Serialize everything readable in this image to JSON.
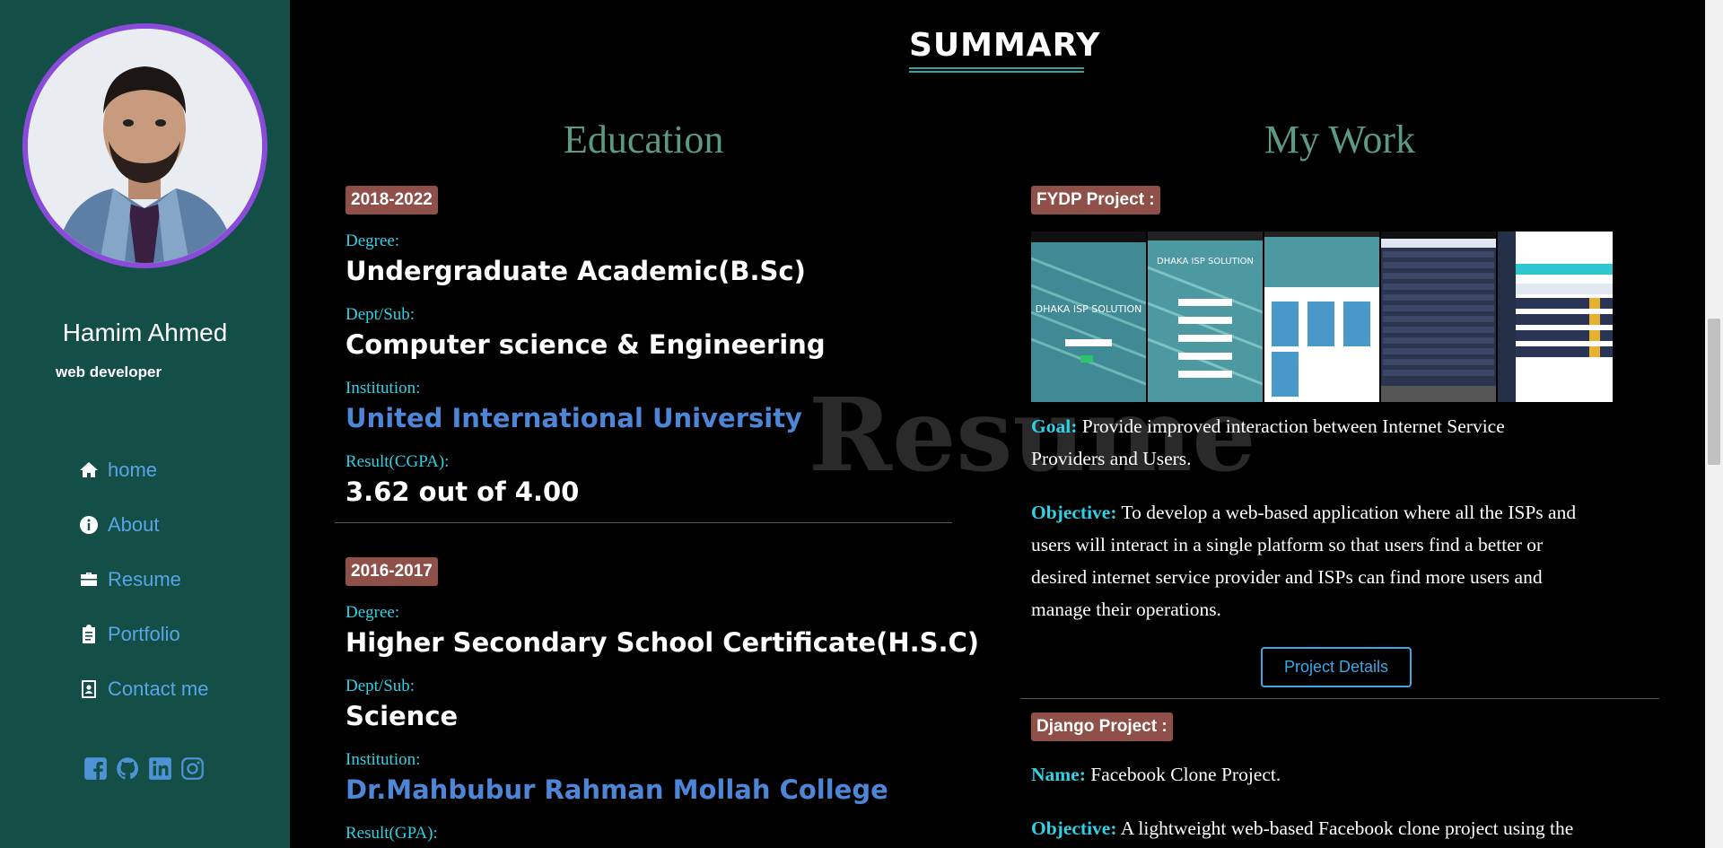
{
  "profile": {
    "name": "Hamim Ahmed",
    "role": "web developer"
  },
  "nav": [
    {
      "icon": "home-icon",
      "label": "home"
    },
    {
      "icon": "info-circle-icon",
      "label": "About"
    },
    {
      "icon": "briefcase-icon",
      "label": "Resume"
    },
    {
      "icon": "clipboard-icon",
      "label": "Portfolio"
    },
    {
      "icon": "contact-card-icon",
      "label": "Contact me"
    }
  ],
  "socials": [
    "facebook-icon",
    "github-icon",
    "linkedin-icon",
    "instagram-icon"
  ],
  "section": {
    "title": "SUMMARY",
    "watermark": "Resume"
  },
  "education": {
    "title": "Education",
    "entries": [
      {
        "years": "2018-2022",
        "degree_label": "Degree:",
        "degree": "Undergraduate Academic(B.Sc)",
        "dept_label": "Dept/Sub:",
        "dept": "Computer science & Engineering",
        "inst_label": "Institution:",
        "inst": "United International University",
        "result_label": "Result(CGPA):",
        "result": "3.62 out of 4.00"
      },
      {
        "years": "2016-2017",
        "degree_label": "Degree:",
        "degree": "Higher Secondary School Certificate(H.S.C)",
        "dept_label": "Dept/Sub:",
        "dept": "Science",
        "inst_label": "Institution:",
        "inst": "Dr.Mahbubur Rahman Mollah College",
        "result_label": "Result(GPA):"
      }
    ]
  },
  "work": {
    "title": "My Work",
    "fydp": {
      "badge": "FYDP Project :",
      "goal_label": "Goal:",
      "goal_line1": "Provide improved interaction between Internet Service",
      "goal_line2": "Providers and Users.",
      "objective_label": "Objective:",
      "objective_line1": "To develop a web-based application where all the ISPs and",
      "objective_line2": "users will interact in a single platform so that users find a better or",
      "objective_line3": "desired internet service provider and ISPs can find more users and",
      "objective_line4": "manage their operations.",
      "button": "Project Details",
      "shot1_text": "DHAKA ISP SOLUTION",
      "shot2_text": "DHAKA ISP SOLUTION"
    },
    "django": {
      "badge": "Django Project :",
      "name_label": "Name:",
      "name": "Facebook Clone Project.",
      "objective_label": "Objective:",
      "objective": "A lightweight web-based Facebook clone project using the"
    }
  },
  "colors": {
    "sidebar": "#144f47",
    "accent": "#2ed2e6",
    "badge": "#8e5048",
    "link": "#4d86d6",
    "avatar_ring": "#8a4bdb"
  }
}
